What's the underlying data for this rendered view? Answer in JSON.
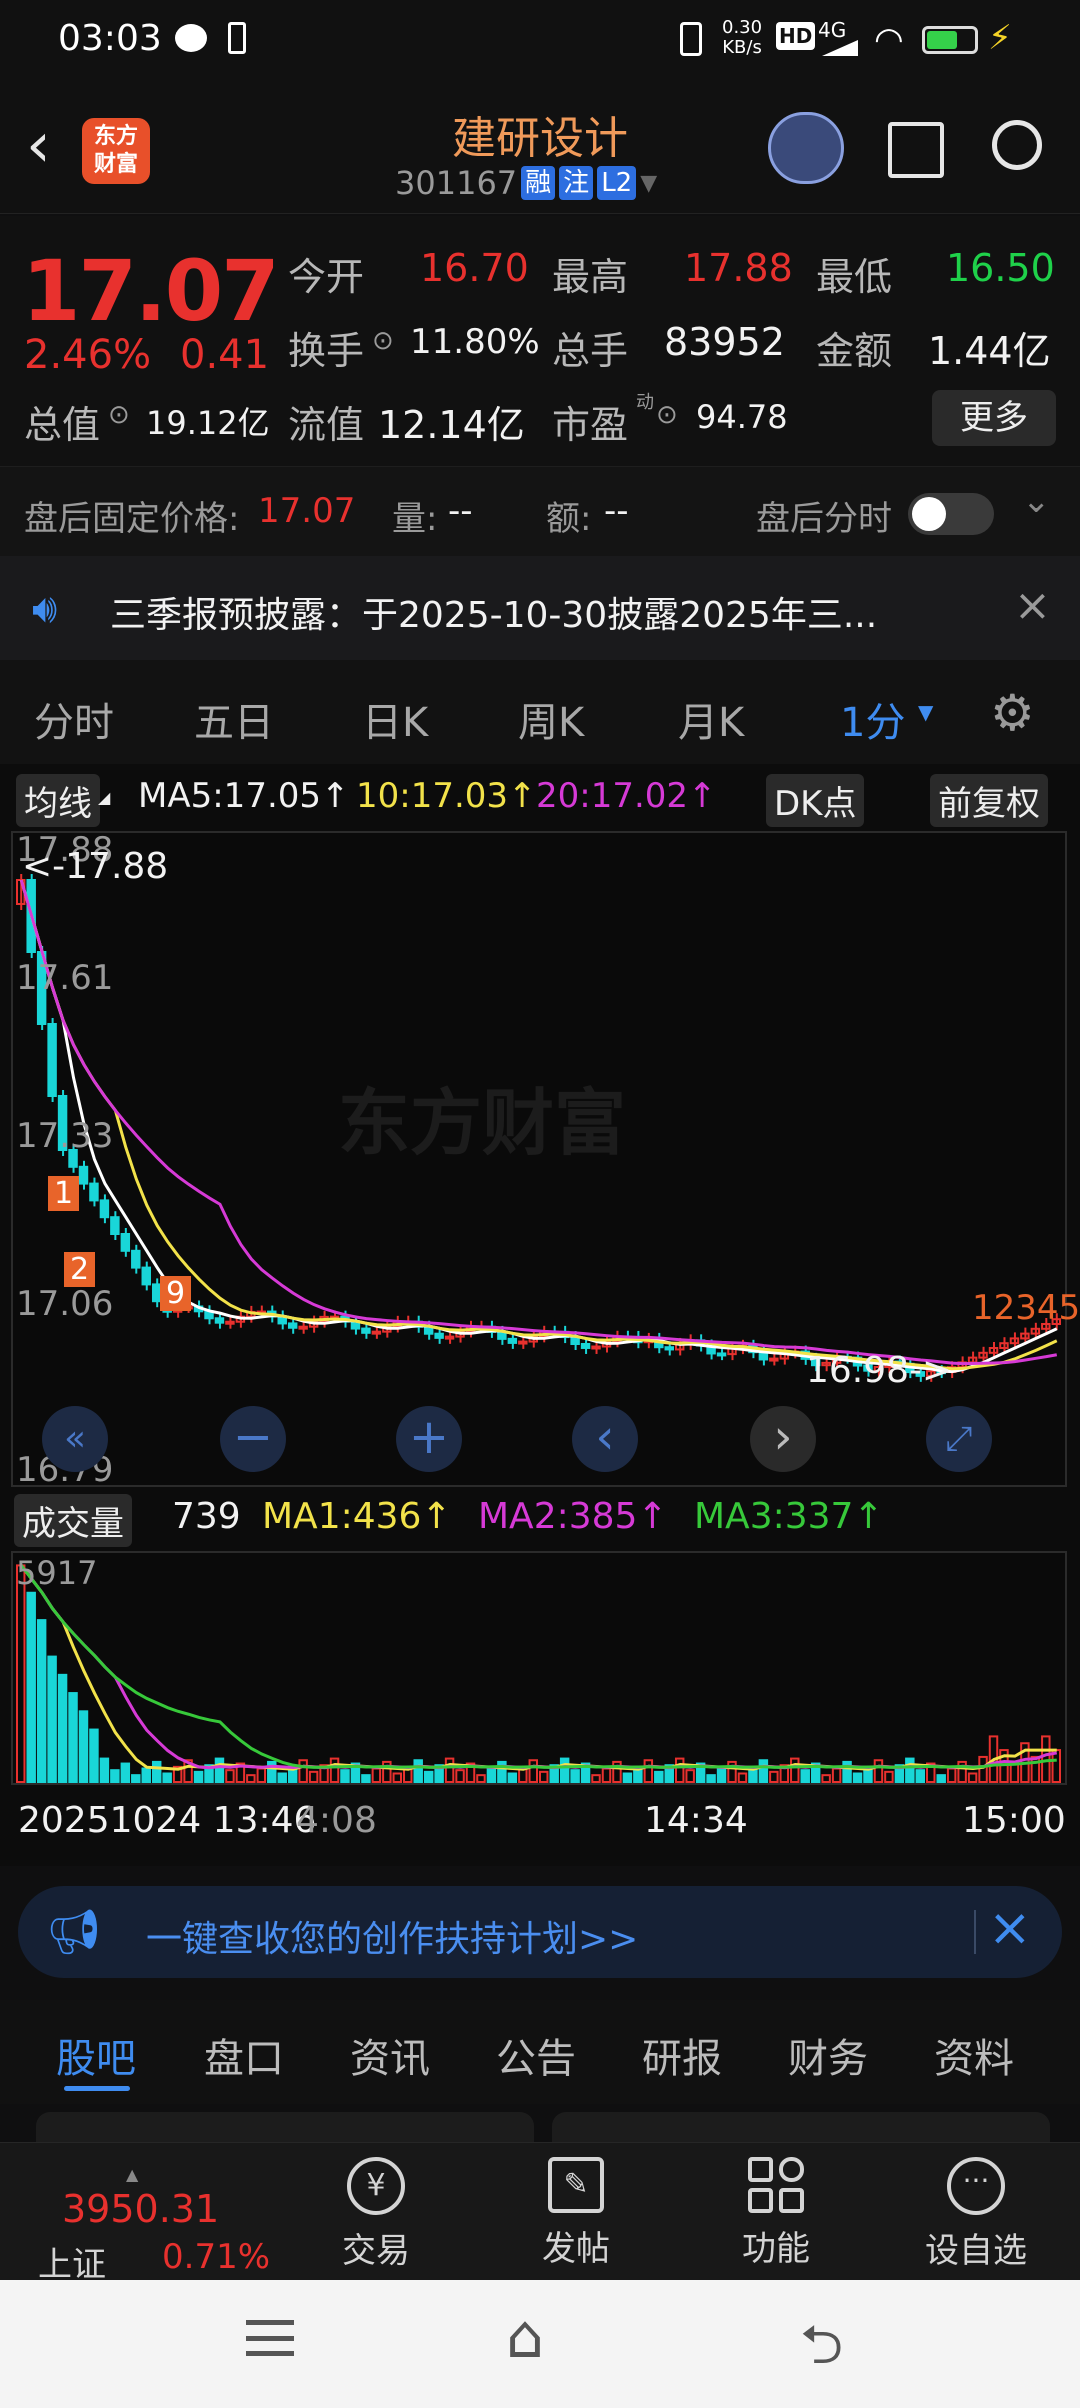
{
  "status_bar": {
    "time": "03:03",
    "net_speed": "0.30",
    "net_unit": "KB/s",
    "hd": "HD",
    "signal": "4G"
  },
  "header": {
    "stock_name": "建研设计",
    "stock_code": "301167",
    "tags": [
      "融",
      "注",
      "L2"
    ]
  },
  "quote": {
    "price": "17.07",
    "change_pct": "2.46%",
    "change_abs": "0.41",
    "open_label": "今开",
    "open": "16.70",
    "high_label": "最高",
    "high": "17.88",
    "low_label": "最低",
    "low": "16.50",
    "turnover_label": "换手",
    "turnover": "11.80%",
    "volume_label": "总手",
    "volume": "83952",
    "amount_label": "金额",
    "amount": "1.44亿",
    "mktcap_label": "总值",
    "mktcap": "19.12亿",
    "float_label": "流值",
    "float_cap": "12.14亿",
    "pe_label": "市盈",
    "pe_sup": "动",
    "pe": "94.78",
    "more_label": "更多"
  },
  "after_hours": {
    "price_label": "盘后固定价格:",
    "price": "17.07",
    "vol_label": "量:",
    "vol": "--",
    "amt_label": "额:",
    "amt": "--",
    "chart_label": "盘后分时"
  },
  "notice": {
    "text": "三季报预披露：于2025-10-30披露2025年三..."
  },
  "kline_tabs": [
    "分时",
    "五日",
    "日K",
    "周K",
    "月K",
    "1分"
  ],
  "chart_header": {
    "ma_label": "均线",
    "ma5": "MA5:17.05↑",
    "ma10": "10:17.03↑",
    "ma20": "20:17.02↑",
    "dk_label": "DK点",
    "adj_label": "前复权"
  },
  "price_axis": {
    "labels": [
      "17.88",
      "17.61",
      "17.33",
      "17.06",
      "16.79"
    ],
    "high_marker": "<-17.88",
    "low_marker": "16.98->"
  },
  "volume_header": {
    "label": "成交量",
    "current": "739",
    "ma1": "MA1:436↑",
    "ma2": "MA2:385↑",
    "ma3": "MA3:337↑",
    "max_label": "5917"
  },
  "time_axis": [
    "20251024 13:46",
    "4:08",
    "14:34",
    "15:00"
  ],
  "chart_data": {
    "type": "candlestick",
    "price_range": [
      16.79,
      17.88
    ],
    "volume_max": 5917,
    "ma5_last": 17.05,
    "ma10_last": 17.03,
    "ma20_last": 17.02,
    "volume_current": 739,
    "vol_ma1": 436,
    "vol_ma2": 385,
    "vol_ma3": 337,
    "series_colors": {
      "up": "#e8312e",
      "down": "#19d6d8",
      "ma5": "#ffffff",
      "ma10": "#f2e24a",
      "ma20": "#d63ad6",
      "vol_ma3": "#37c93a"
    }
  },
  "promo": {
    "text": "一键查收您的创作扶持计划>>"
  },
  "bottom_tabs": [
    "股吧",
    "盘口",
    "资讯",
    "公告",
    "研报",
    "财务",
    "资料"
  ],
  "footer": {
    "index_value": "3950.31",
    "index_name": "上证",
    "index_change": "0.71%",
    "items": [
      {
        "label": "交易",
        "icon": "yen-icon"
      },
      {
        "label": "发帖",
        "icon": "edit-icon"
      },
      {
        "label": "功能",
        "icon": "grid-icon"
      },
      {
        "label": "设自选",
        "icon": "more-icon"
      }
    ]
  }
}
